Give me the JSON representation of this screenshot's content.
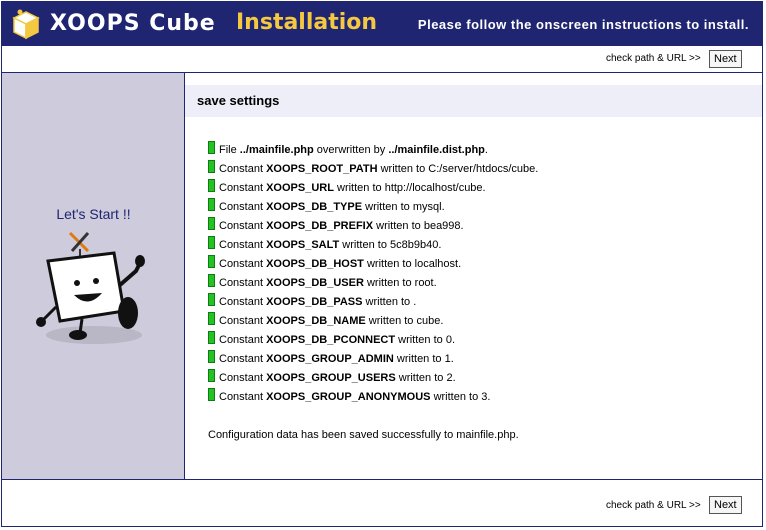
{
  "header": {
    "brand": "XOOPS Cube",
    "title": "Installation",
    "tagline": "Please follow the onscreen instructions to install.",
    "bg_color": "#1f2570",
    "title_color": "#f5c842"
  },
  "nav": {
    "label": "check path & URL >>",
    "next": "Next"
  },
  "sidebar": {
    "lets_start": "Let's Start !!"
  },
  "main": {
    "title": "save settings",
    "log": [
      {
        "pre": "File ",
        "key": "../mainfile.php",
        "mid": " overwritten by ",
        "val": "../mainfile.dist.php",
        "post": "."
      },
      {
        "pre": "Constant ",
        "key": "XOOPS_ROOT_PATH",
        "mid": " written to ",
        "val": "C:/server/htdocs/cube",
        "post": "."
      },
      {
        "pre": "Constant ",
        "key": "XOOPS_URL",
        "mid": " written to ",
        "val": "http://localhost/cube",
        "post": "."
      },
      {
        "pre": "Constant ",
        "key": "XOOPS_DB_TYPE",
        "mid": " written to ",
        "val": "mysql",
        "post": "."
      },
      {
        "pre": "Constant ",
        "key": "XOOPS_DB_PREFIX",
        "mid": " written to ",
        "val": "bea998",
        "post": "."
      },
      {
        "pre": "Constant ",
        "key": "XOOPS_SALT",
        "mid": " written to ",
        "val": "5c8b9b40",
        "post": "."
      },
      {
        "pre": "Constant ",
        "key": "XOOPS_DB_HOST",
        "mid": " written to ",
        "val": "localhost",
        "post": "."
      },
      {
        "pre": "Constant ",
        "key": "XOOPS_DB_USER",
        "mid": " written to ",
        "val": "root",
        "post": "."
      },
      {
        "pre": "Constant ",
        "key": "XOOPS_DB_PASS",
        "mid": " written to ",
        "val": "",
        "post": "."
      },
      {
        "pre": "Constant ",
        "key": "XOOPS_DB_NAME",
        "mid": " written to ",
        "val": "cube",
        "post": "."
      },
      {
        "pre": "Constant ",
        "key": "XOOPS_DB_PCONNECT",
        "mid": " written to ",
        "val": "0",
        "post": "."
      },
      {
        "pre": "Constant ",
        "key": "XOOPS_GROUP_ADMIN",
        "mid": " written to ",
        "val": "1",
        "post": "."
      },
      {
        "pre": "Constant ",
        "key": "XOOPS_GROUP_USERS",
        "mid": " written to ",
        "val": "2",
        "post": "."
      },
      {
        "pre": "Constant ",
        "key": "XOOPS_GROUP_ANONYMOUS",
        "mid": " written to ",
        "val": "3",
        "post": "."
      }
    ],
    "result": "Configuration data has been saved successfully to mainfile.php."
  }
}
